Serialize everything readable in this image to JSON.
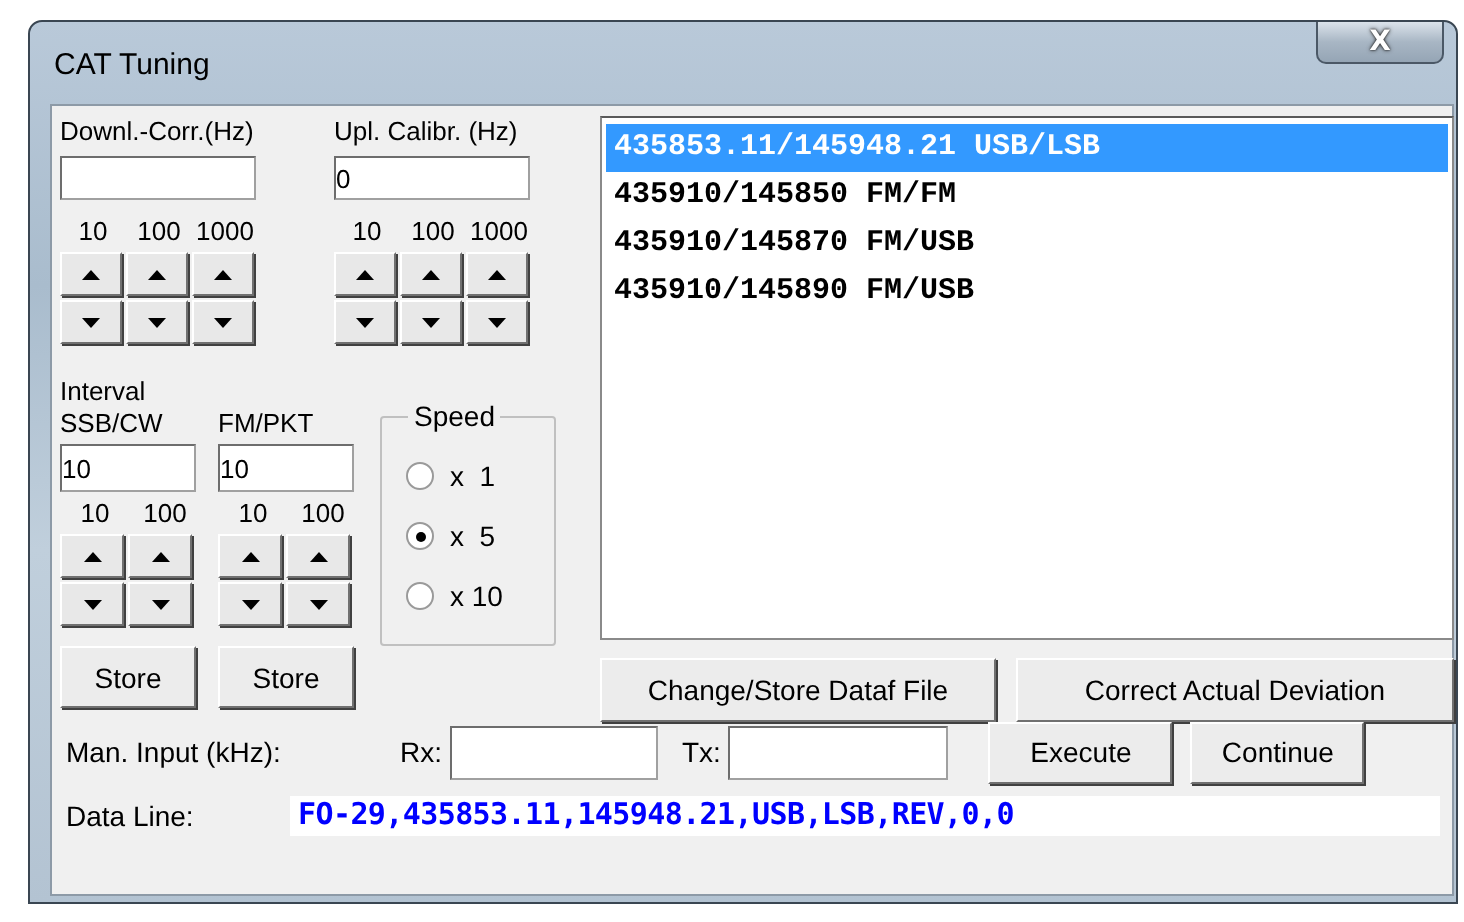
{
  "window": {
    "title": "CAT Tuning",
    "close": "X"
  },
  "downlink": {
    "label": "Downl.-Corr.(Hz)",
    "steps": [
      "10",
      "100",
      "1000"
    ]
  },
  "uplink": {
    "label": "Upl. Calibr. (Hz)",
    "value": "0",
    "steps": [
      "10",
      "100",
      "1000"
    ]
  },
  "interval": {
    "label": "Interval",
    "groups": [
      {
        "label": "SSB/CW",
        "value": "10",
        "steps": [
          "10",
          "100"
        ],
        "store": "Store"
      },
      {
        "label": "FM/PKT",
        "value": "10",
        "steps": [
          "10",
          "100"
        ],
        "store": "Store"
      }
    ]
  },
  "speed": {
    "label": "Speed",
    "options": [
      {
        "label": "x  1",
        "selected": false
      },
      {
        "label": "x  5",
        "selected": true
      },
      {
        "label": "x 10",
        "selected": false
      }
    ]
  },
  "list": {
    "items": [
      {
        "text": "435853.11/145948.21 USB/LSB",
        "selected": true
      },
      {
        "text": "435910/145850 FM/FM",
        "selected": false
      },
      {
        "text": "435910/145870 FM/USB",
        "selected": false
      },
      {
        "text": "435910/145890 FM/USB",
        "selected": false
      }
    ]
  },
  "list_buttons": [
    "Change/Store Dataf File",
    "Correct Actual Deviation"
  ],
  "manual": {
    "label": "Man. Input (kHz):",
    "rx_label": "Rx:",
    "tx_label": "Tx:",
    "buttons": [
      "Execute",
      "Continue"
    ]
  },
  "data_line": {
    "label": "Data Line:",
    "value": "FO-29,435853.11,145948.21,USB,LSB,REV,0,0"
  }
}
